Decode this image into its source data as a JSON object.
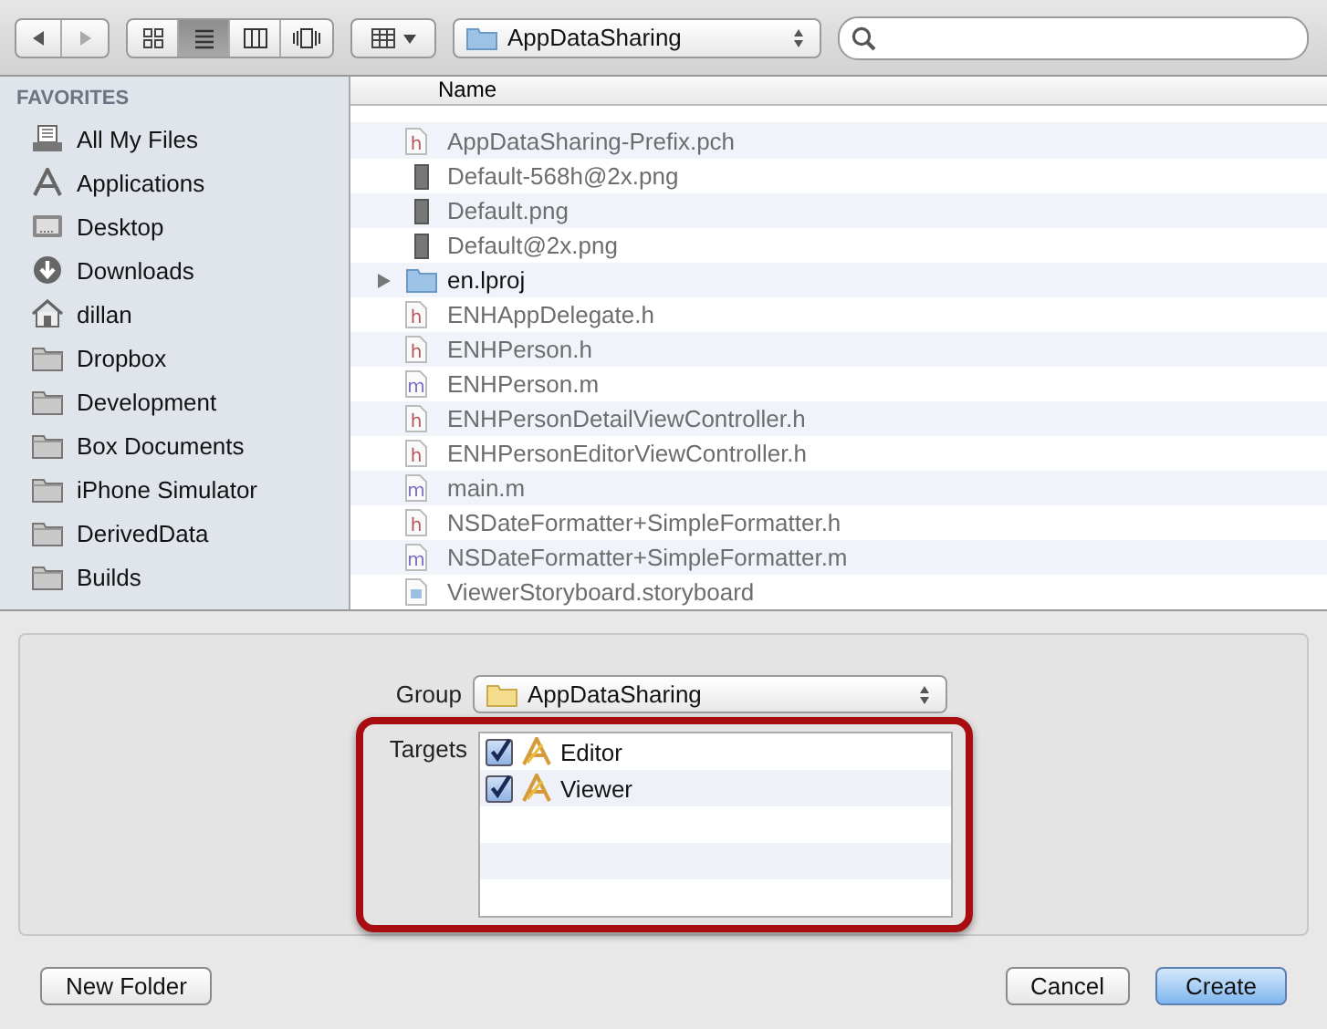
{
  "toolbar": {
    "location": "AppDataSharing",
    "view_modes": [
      {
        "kind": "icons",
        "selected": false
      },
      {
        "kind": "list",
        "selected": true
      },
      {
        "kind": "columns",
        "selected": false
      },
      {
        "kind": "coverflow",
        "selected": false
      }
    ]
  },
  "sidebar": {
    "heading": "FAVORITES",
    "items": [
      {
        "label": "All My Files",
        "kind": "allfiles"
      },
      {
        "label": "Applications",
        "kind": "apps"
      },
      {
        "label": "Desktop",
        "kind": "desktop"
      },
      {
        "label": "Downloads",
        "kind": "downloads"
      },
      {
        "label": "dillan",
        "kind": "home"
      },
      {
        "label": "Dropbox",
        "kind": "folder"
      },
      {
        "label": "Development",
        "kind": "folder"
      },
      {
        "label": "Box Documents",
        "kind": "folder"
      },
      {
        "label": "iPhone Simulator",
        "kind": "folder"
      },
      {
        "label": "DerivedData",
        "kind": "folder"
      },
      {
        "label": "Builds",
        "kind": "folder"
      }
    ]
  },
  "file_list": {
    "column": "Name",
    "rows": [
      {
        "name": "AppDataSharing-Prefix.pch",
        "kind": "source",
        "badge": "h"
      },
      {
        "name": "Default-568h@2x.png",
        "kind": "image"
      },
      {
        "name": "Default.png",
        "kind": "image"
      },
      {
        "name": "Default@2x.png",
        "kind": "image"
      },
      {
        "name": "en.lproj",
        "kind": "folder",
        "expanded": false
      },
      {
        "name": "ENHAppDelegate.h",
        "kind": "source",
        "badge": "h"
      },
      {
        "name": "ENHPerson.h",
        "kind": "source",
        "badge": "h"
      },
      {
        "name": "ENHPerson.m",
        "kind": "source",
        "badge": "m"
      },
      {
        "name": "ENHPersonDetailViewController.h",
        "kind": "source",
        "badge": "h"
      },
      {
        "name": "ENHPersonEditorViewController.h",
        "kind": "source",
        "badge": "h"
      },
      {
        "name": "main.m",
        "kind": "source",
        "badge": "m"
      },
      {
        "name": "NSDateFormatter+SimpleFormatter.h",
        "kind": "source",
        "badge": "h"
      },
      {
        "name": "NSDateFormatter+SimpleFormatter.m",
        "kind": "source",
        "badge": "m"
      },
      {
        "name": "ViewerStoryboard.storyboard",
        "kind": "storyboard"
      }
    ]
  },
  "options": {
    "group_label": "Group",
    "group": "AppDataSharing",
    "targets_label": "Targets",
    "targets": [
      {
        "name": "Editor",
        "checked": true
      },
      {
        "name": "Viewer",
        "checked": true
      }
    ]
  },
  "buttons": {
    "new_folder": "New Folder",
    "cancel": "Cancel",
    "create": "Create"
  }
}
